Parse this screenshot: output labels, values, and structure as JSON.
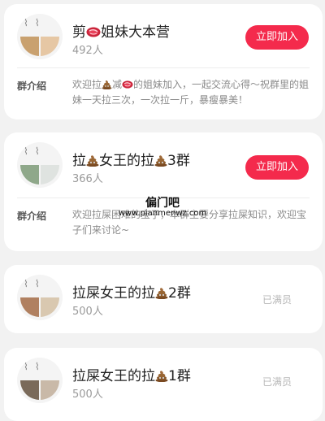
{
  "groups": [
    {
      "title_before": "剪",
      "title_after": "姐妹大本营",
      "members": "492人",
      "action": "立即加入",
      "intro_label": "群介绍",
      "intro_1": "欢迎拉",
      "intro_2": "减",
      "intro_3": "的姐妹加入，一起交流心得～祝群里的姐妹一天拉三次，一次拉一斤，暴瘦暴美！"
    },
    {
      "title_1": "拉",
      "title_2": "女王的拉",
      "title_3": "3群",
      "members": "366人",
      "action": "立即加入",
      "intro_label": "群介绍",
      "intro": "欢迎拉屎困难的宝子，本群主要分享拉屎知识，欢迎宝子们来讨论~"
    },
    {
      "title_before": "拉屎女王的拉",
      "title_after": "2群",
      "members": "500人",
      "status": "已满员"
    },
    {
      "title_before": "拉屎女王的拉",
      "title_after": "1群",
      "members": "500人",
      "status": "已满员"
    }
  ],
  "watermark": {
    "name": "偏门吧",
    "url": "www.pianmenwz.com"
  },
  "colors": {
    "accent": "#f42a4c",
    "background": "#f2f2f2"
  }
}
